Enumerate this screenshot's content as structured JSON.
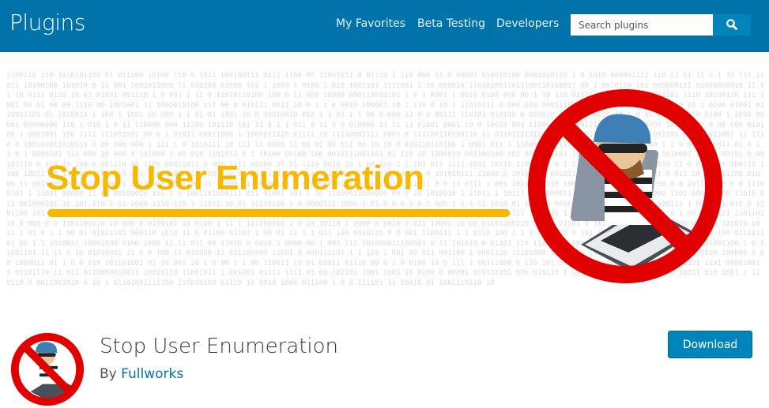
{
  "header": {
    "title": "Plugins",
    "nav": [
      "My Favorites",
      "Beta Testing",
      "Developers"
    ],
    "search_placeholder": "Search plugins",
    "search_icon": "search-icon"
  },
  "banner": {
    "heading": "Stop User Enumeration",
    "colors": {
      "heading": "#f6b800",
      "prohibition": "#e00000"
    }
  },
  "plugin": {
    "name": "Stop User Enumeration",
    "by_label": "By",
    "author": "Fullworks",
    "download_label": "Download"
  },
  "colors": {
    "header_bg": "#0073aa",
    "button_bg": "#0085ba"
  }
}
